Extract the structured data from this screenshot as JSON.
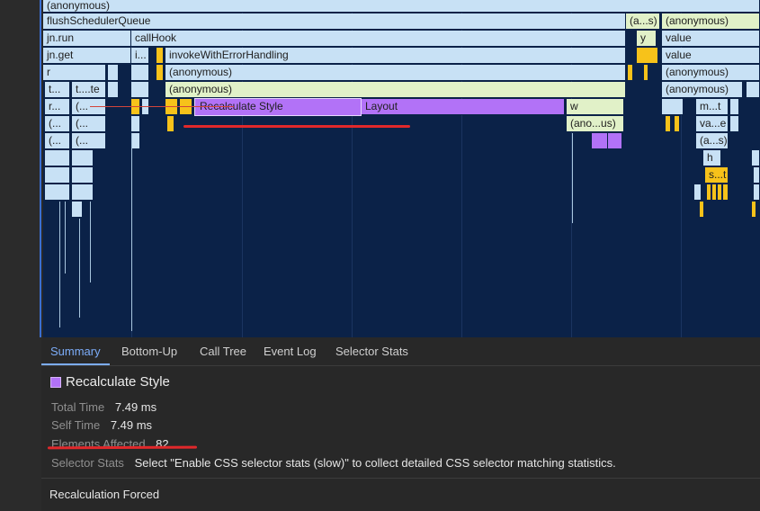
{
  "flame": {
    "row0": [
      "(anonymous)"
    ],
    "row1": [
      "flushSchedulerQueue",
      "(a...s)",
      "(anonymous)"
    ],
    "row2": [
      "jn.run",
      "callHook",
      "y",
      "value"
    ],
    "row3": [
      "jn.get",
      "i...",
      "invokeWithErrorHandling",
      "value"
    ],
    "row4": [
      "r",
      "(anonymous)",
      "(anonymous)"
    ],
    "row5": [
      "t...",
      "t....te",
      "(anonymous)",
      "(anonymous)"
    ],
    "row6": [
      "r...",
      "(...",
      "Recalculate Style",
      "Layout",
      "w",
      "m...t"
    ],
    "row7": [
      "(...",
      "(...",
      "(ano...us)",
      "va...e"
    ],
    "row8": [
      "(...",
      "(...",
      "(a...s)"
    ],
    "row9": [
      "h"
    ],
    "row10": [
      "s...t"
    ]
  },
  "tabs": [
    "Summary",
    "Bottom-Up",
    "Call Tree",
    "Event Log",
    "Selector Stats"
  ],
  "summary": {
    "title": "Recalculate Style",
    "total_time_label": "Total Time",
    "total_time": "7.49 ms",
    "self_time_label": "Self Time",
    "self_time": "7.49 ms",
    "elements_affected_label": "Elements Affected",
    "elements_affected": "82",
    "selector_stats_label": "Selector Stats",
    "selector_stats_text": "Select \"Enable CSS selector stats (slow)\" to collect detailed CSS selector matching statistics.",
    "swatch_color": "#b272f7"
  },
  "footer": {
    "recalc_forced": "Recalculation Forced"
  }
}
